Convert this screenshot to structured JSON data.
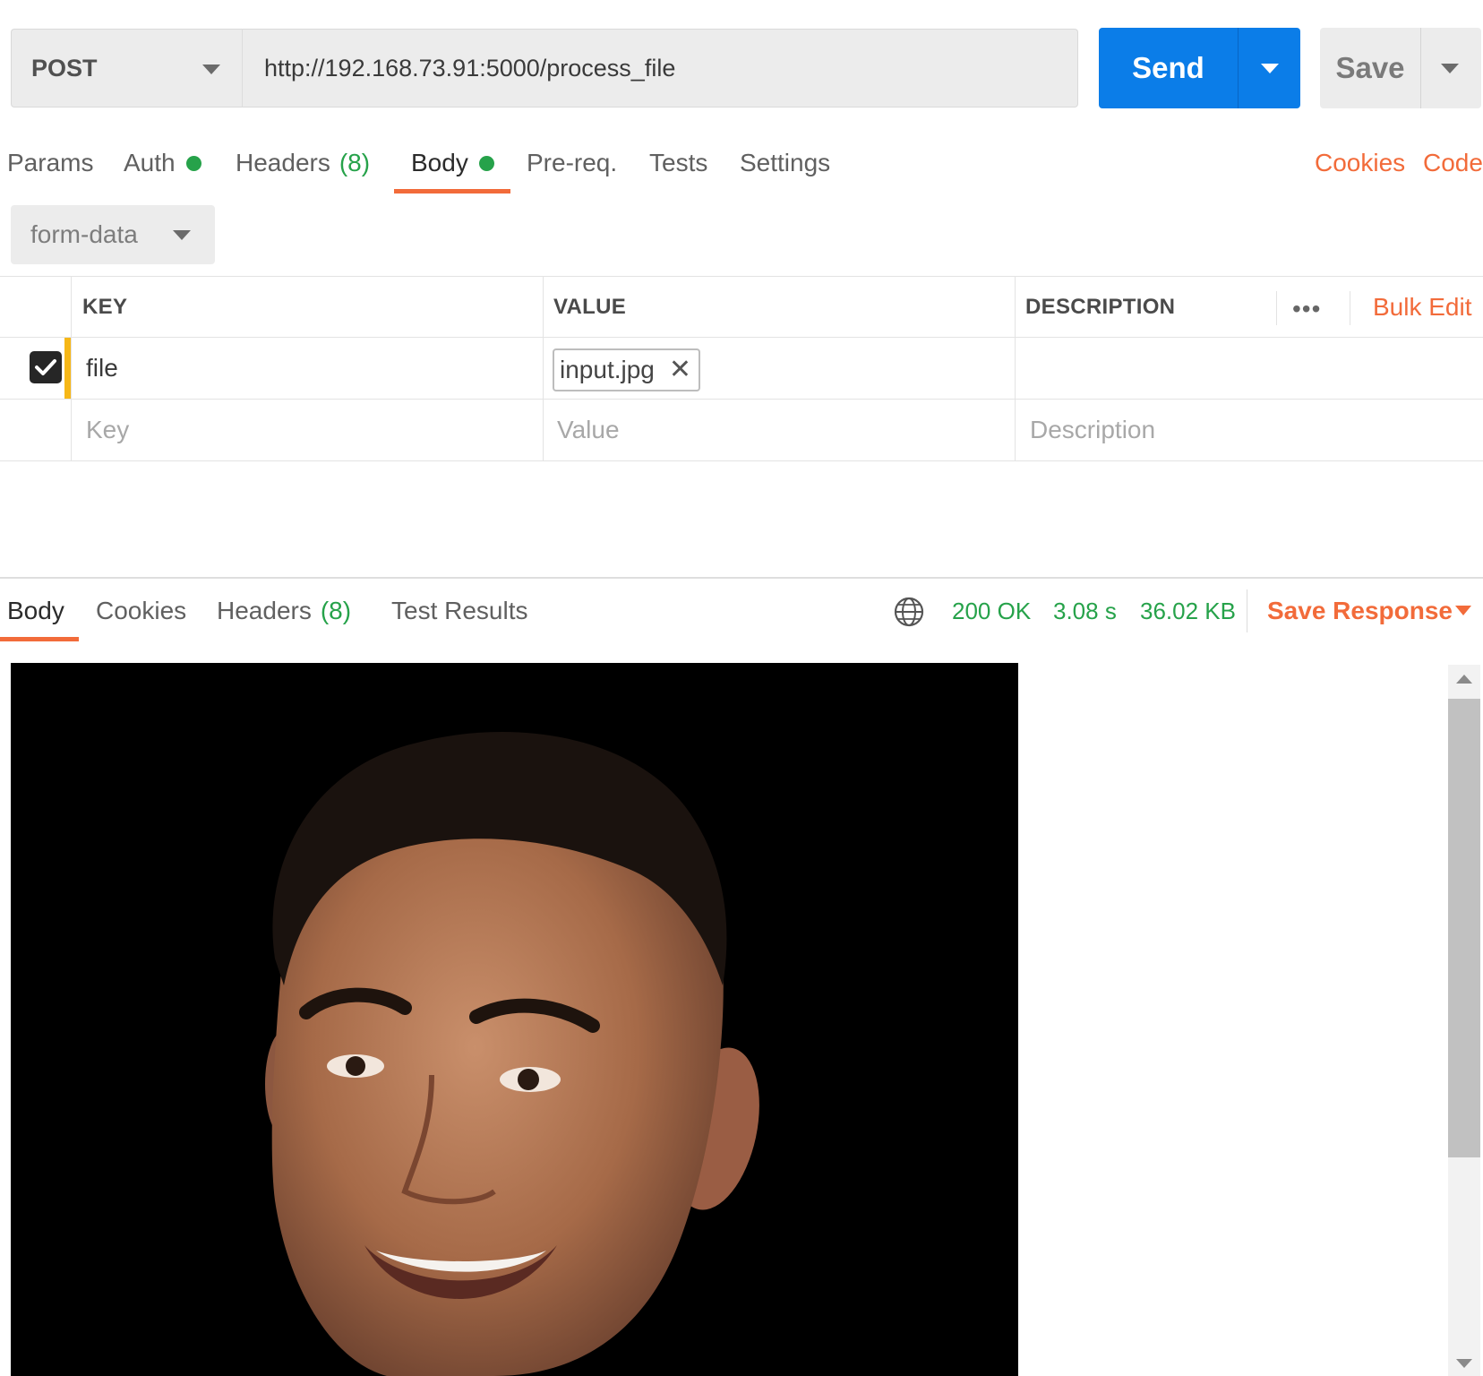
{
  "request": {
    "method": "POST",
    "url": "http://192.168.73.91:5000/process_file",
    "send_label": "Send",
    "save_label": "Save"
  },
  "request_tabs": {
    "params": "Params",
    "auth": "Auth",
    "headers": "Headers",
    "headers_count": "(8)",
    "body": "Body",
    "prereq": "Pre-req.",
    "tests": "Tests",
    "settings": "Settings",
    "cookies": "Cookies",
    "code": "Code",
    "active": "Body"
  },
  "body_type": "form-data",
  "form_table": {
    "headers": {
      "key": "KEY",
      "value": "VALUE",
      "description": "DESCRIPTION"
    },
    "more_label": "•••",
    "bulk_edit": "Bulk Edit",
    "rows": [
      {
        "checked": true,
        "key": "file",
        "value": "input.jpg",
        "description": ""
      }
    ],
    "placeholders": {
      "key": "Key",
      "value": "Value",
      "description": "Description"
    }
  },
  "response_tabs": {
    "body": "Body",
    "cookies": "Cookies",
    "headers": "Headers",
    "headers_count": "(8)",
    "test_results": "Test Results",
    "active": "Body"
  },
  "response_status": {
    "status": "200 OK",
    "time": "3.08 s",
    "size": "36.02 KB",
    "save_response": "Save Response"
  },
  "colors": {
    "accent": "#f26b3a",
    "send_button": "#0b7de8",
    "success": "#26a24a",
    "row_marker": "#f6b717"
  },
  "icons": [
    "chevron-down-icon",
    "globe-icon",
    "close-icon",
    "checkbox-checked-icon",
    "more-horizontal-icon"
  ]
}
